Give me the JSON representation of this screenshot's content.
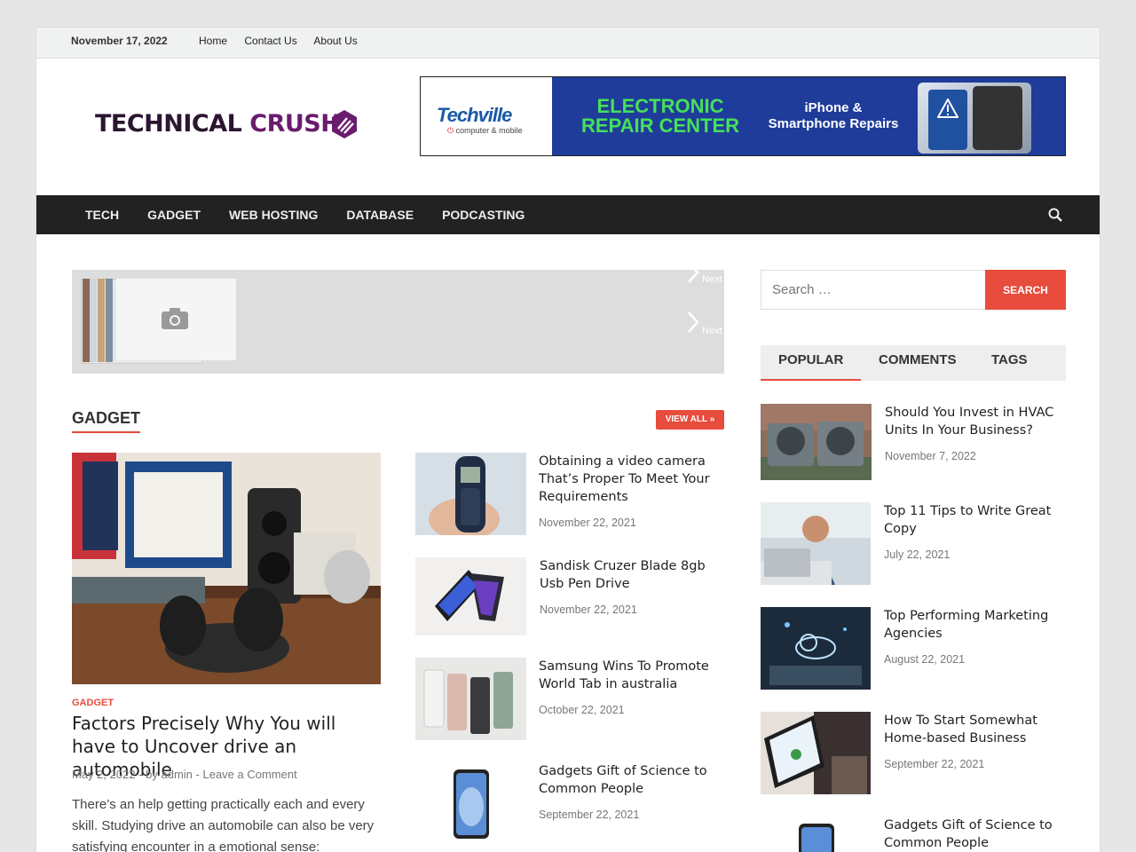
{
  "topbar": {
    "date": "November 17, 2022",
    "links": [
      "Home",
      "Contact Us",
      "About Us"
    ]
  },
  "logo": {
    "text_a": "TECHNICAL",
    "text_b": "CRUSH"
  },
  "banner": {
    "brand": "Techville",
    "tagline_a": "computer & mobile",
    "headline_a": "ELECTRONIC",
    "headline_b": "REPAIR CENTER",
    "sub_a": "iPhone &",
    "sub_b": "Smartphone Repairs"
  },
  "nav": {
    "items": [
      "TECH",
      "GADGET",
      "WEB HOSTING",
      "DATABASE",
      "PODCASTING"
    ],
    "search_icon": "search-icon"
  },
  "slider": {
    "next_label": "Next"
  },
  "gadget": {
    "section_title": "GADGET",
    "view_all": "VIEW ALL »",
    "featured": {
      "category": "GADGET",
      "title": "Factors Precisely Why You will have to Uncover drive an automobile",
      "date": "May 2, 2022",
      "sep": "-",
      "by": "by admin",
      "comment": "Leave a Comment",
      "excerpt": "There’s an help getting practically each and every skill. Studying drive an automobile can also be very satisfying encounter in a emotional sense:"
    },
    "posts": [
      {
        "title": "Obtaining a video camera That’s Proper To Meet Your Requirements",
        "date": "November 22, 2021"
      },
      {
        "title": "Sandisk Cruzer Blade 8gb Usb Pen Drive",
        "date": "November 22, 2021"
      },
      {
        "title": "Samsung Wins To Promote World Tab in australia",
        "date": "October 22, 2021"
      },
      {
        "title": "Gadgets Gift of Science to Common People",
        "date": "September 22, 2021"
      }
    ]
  },
  "sidebar": {
    "search_placeholder": "Search …",
    "search_button": "SEARCH",
    "tabs": [
      "POPULAR",
      "COMMENTS",
      "TAGS"
    ],
    "popular": [
      {
        "title": "Should You Invest in HVAC Units In Your Business?",
        "date": "November 7, 2022"
      },
      {
        "title": "Top 11 Tips to Write Great Copy",
        "date": "July 22, 2021"
      },
      {
        "title": "Top Performing Marketing Agencies",
        "date": "August 22, 2021"
      },
      {
        "title": "How To Start Somewhat Home-based Business",
        "date": "September 22, 2021"
      },
      {
        "title": "Gadgets Gift of Science to Common People",
        "date": ""
      }
    ]
  },
  "colors": {
    "accent": "#e74c3c",
    "nav_bg": "#222222",
    "topbar_bg": "#f0f2f2"
  }
}
